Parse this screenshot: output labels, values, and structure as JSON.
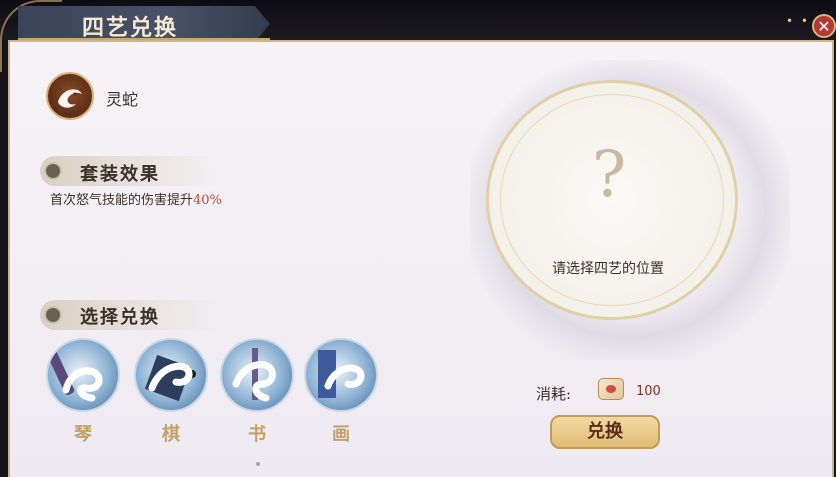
{
  "window": {
    "title": "四艺兑换",
    "close_icon": "close-icon",
    "more_icon": "more-dots-icon",
    "dots": "• • •"
  },
  "skin": {
    "name": "灵蛇",
    "icon": "snake-head-icon"
  },
  "set_effect": {
    "heading": "套装效果",
    "text_prefix": "首次怒气技能的伤害提升",
    "text_value": "40%"
  },
  "selection": {
    "heading": "选择兑换",
    "items": [
      {
        "label": "琴",
        "icon": "qin-snake-icon"
      },
      {
        "label": "棋",
        "icon": "chess-snake-icon"
      },
      {
        "label": "书",
        "icon": "book-snake-icon"
      },
      {
        "label": "画",
        "icon": "painting-snake-icon"
      }
    ]
  },
  "preview": {
    "placeholder_symbol": "?",
    "prompt": "请选择四艺的位置"
  },
  "cost": {
    "label": "消耗:",
    "value": "100",
    "icon": "coupon-icon"
  },
  "actions": {
    "exchange_label": "兑换"
  },
  "colors": {
    "accent_gold": "#c9a86c",
    "highlight_red": "#c24a32",
    "close_red": "#b23a33"
  }
}
